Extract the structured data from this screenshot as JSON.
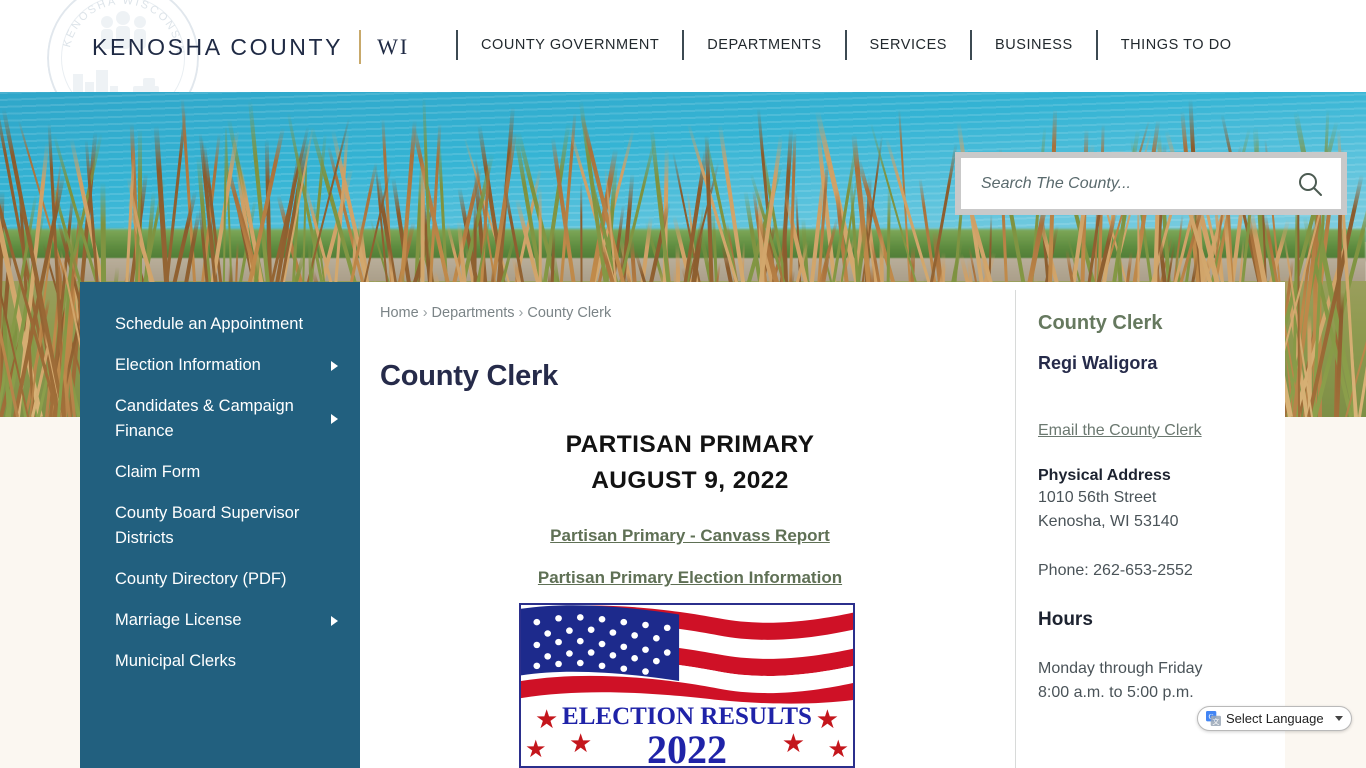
{
  "header": {
    "brand_name": "KENOSHA COUNTY",
    "brand_state": "WI",
    "seal_icon": "kenosha-county-seal-watermark",
    "nav": [
      {
        "label": "COUNTY GOVERNMENT"
      },
      {
        "label": "DEPARTMENTS"
      },
      {
        "label": "SERVICES"
      },
      {
        "label": "BUSINESS"
      },
      {
        "label": "THINGS TO DO"
      }
    ]
  },
  "search": {
    "placeholder": "Search The County...",
    "value": "",
    "icon": "search-icon"
  },
  "sidebar": {
    "items": [
      {
        "label": "Schedule an Appointment",
        "has_submenu": false
      },
      {
        "label": "Election Information",
        "has_submenu": true
      },
      {
        "label": "Candidates & Campaign Finance",
        "has_submenu": true
      },
      {
        "label": "Claim Form",
        "has_submenu": false
      },
      {
        "label": "County Board Supervisor Districts",
        "has_submenu": false
      },
      {
        "label": "County Directory (PDF)",
        "has_submenu": false
      },
      {
        "label": "Marriage License",
        "has_submenu": true
      },
      {
        "label": "Municipal Clerks",
        "has_submenu": false
      }
    ]
  },
  "breadcrumb": {
    "items": [
      "Home",
      "Departments",
      "County Clerk"
    ],
    "separator": "›"
  },
  "main": {
    "page_title": "County Clerk",
    "heading_line1": "PARTISAN PRIMARY",
    "heading_line2": "AUGUST 9, 2022",
    "link_canvass": "Partisan Primary - Canvass Report",
    "link_info": "Partisan Primary Election Information",
    "election_image": {
      "alt": "election-results-2022-flag-graphic",
      "text_line1": "ELECTION RESULTS",
      "text_line2": "2022",
      "flag_icon": "american-flag-icon",
      "star_icon": "star-icon"
    }
  },
  "contact": {
    "title": "County Clerk",
    "name": "Regi Waligora",
    "email_link": "Email the County Clerk",
    "address_label": "Physical Address",
    "address_line1": "1010 56th Street",
    "address_line2": "Kenosha, WI 53140",
    "phone": "Phone: 262-653-2552",
    "hours_label": "Hours",
    "hours_line1": "Monday through Friday",
    "hours_line2": "8:00 a.m. to 5:00 p.m."
  },
  "translate": {
    "label": "Select Language",
    "icon": "google-translate-icon",
    "caret": "chevron-down-icon"
  },
  "colors": {
    "sidebar_blue": "#22607f",
    "brand_navy": "#1f2a44",
    "accent_gold": "#c8a96b",
    "link_green": "#5f7055",
    "page_bg": "#fbf7f1"
  }
}
